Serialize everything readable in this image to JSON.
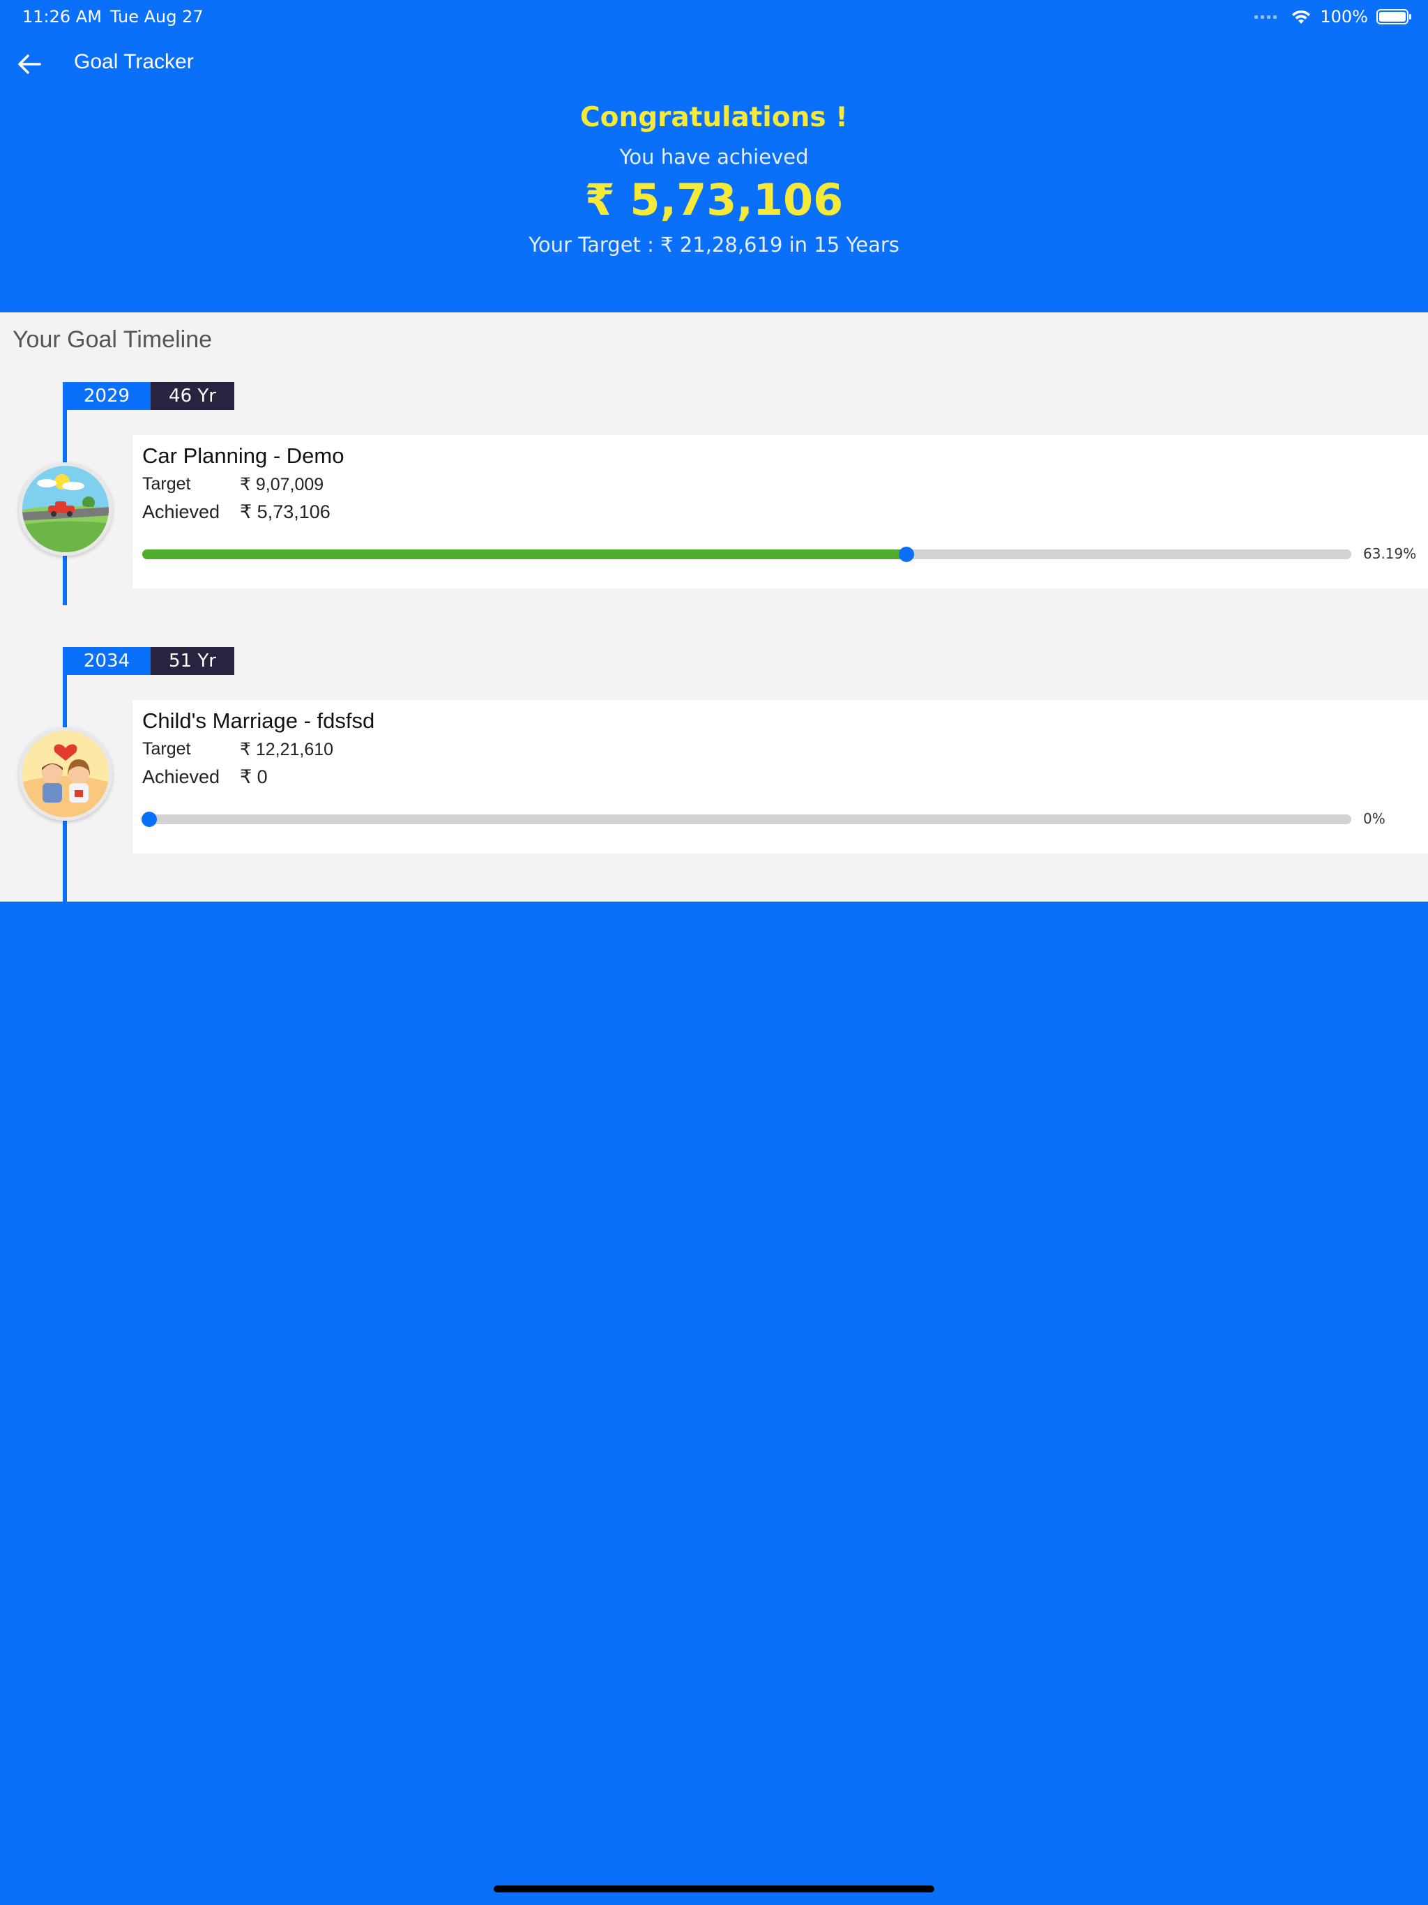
{
  "status_bar": {
    "time": "11:26 AM",
    "date": "Tue Aug 27",
    "battery": "100%",
    "icons": [
      "cellular-dots-icon",
      "wifi-icon",
      "battery-icon"
    ]
  },
  "nav": {
    "title": "Goal Tracker",
    "back_icon": "back-arrow-icon"
  },
  "summary": {
    "congrats": "Congratulations !",
    "achieved_label": "You have achieved",
    "achieved_amount": "₹ 5,73,106",
    "target_line": "Your Target : ₹ 21,28,619 in 15 Years"
  },
  "timeline": {
    "title": "Your Goal Timeline",
    "goals": [
      {
        "year": "2029",
        "age": "46 Yr",
        "name": "Car Planning - Demo",
        "target_label": "Target",
        "target_value": "₹ 9,07,009",
        "achieved_label": "Achieved",
        "achieved_value": "₹ 5,73,106",
        "progress_percent": 63.19,
        "progress_label": "63.19%",
        "icon": "car-illustration-icon"
      },
      {
        "year": "2034",
        "age": "51 Yr",
        "name": "Child's Marriage - fdsfsd",
        "target_label": "Target",
        "target_value": "₹ 12,21,610",
        "achieved_label": "Achieved",
        "achieved_value": "₹ 0",
        "progress_percent": 0,
        "progress_label": "0%",
        "icon": "couple-illustration-icon"
      }
    ]
  },
  "colors": {
    "primary": "#0a6ff9",
    "highlight": "#f5e93a",
    "progress_fill": "#4fae2e",
    "age_tag": "#2a2340",
    "panel_bg": "#f3f3f3"
  }
}
